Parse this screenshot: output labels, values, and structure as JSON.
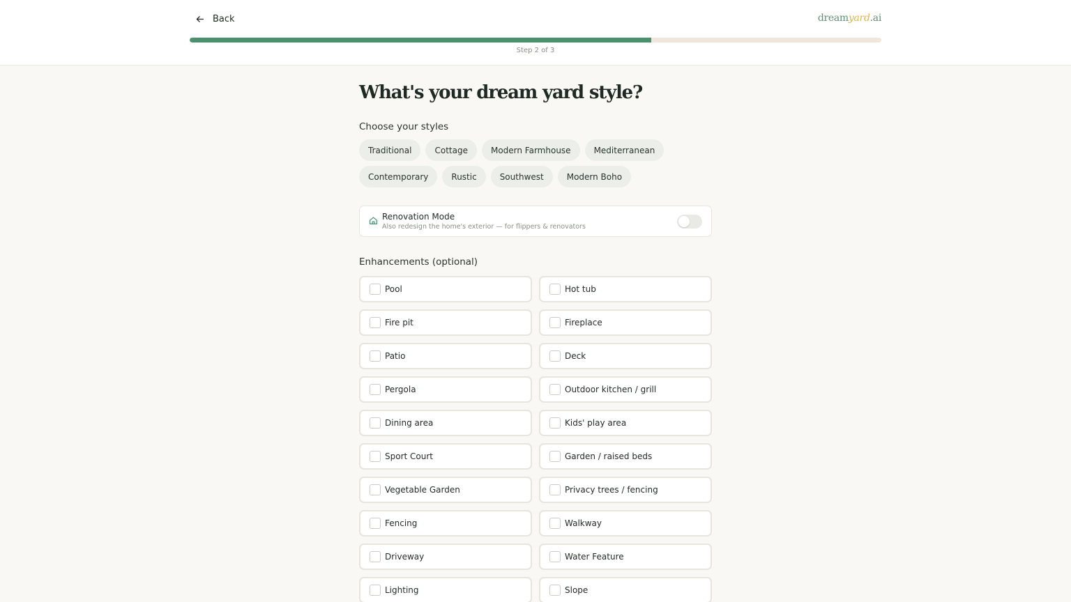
{
  "header": {
    "back_label": "Back",
    "logo": {
      "part1": "dream",
      "part2": "yard",
      "part3": ".ai"
    },
    "progress": 0.667,
    "step_label": "Step 2 of 3"
  },
  "colors": {
    "accent": "#4c9070",
    "logo_gold": "#e0b552",
    "background": "#f9f8f4"
  },
  "page": {
    "title": "What's your dream yard style?",
    "styles_label": "Choose your styles",
    "styles": [
      "Traditional",
      "Cottage",
      "Modern Farmhouse",
      "Mediterranean",
      "Contemporary",
      "Rustic",
      "Southwest",
      "Modern Boho"
    ],
    "renovation": {
      "icon": "home-icon",
      "title": "Renovation Mode",
      "subtitle": "Also redesign the home's exterior — for flippers & renovators",
      "enabled": false
    },
    "enhancements_label": "Enhancements (optional)",
    "enhancements": [
      "Pool",
      "Hot tub",
      "Fire pit",
      "Fireplace",
      "Patio",
      "Deck",
      "Pergola",
      "Outdoor kitchen / grill",
      "Dining area",
      "Kids' play area",
      "Sport Court",
      "Garden / raised beds",
      "Vegetable Garden",
      "Privacy trees / fencing",
      "Fencing",
      "Walkway",
      "Driveway",
      "Water Feature",
      "Lighting",
      "Slope"
    ]
  }
}
